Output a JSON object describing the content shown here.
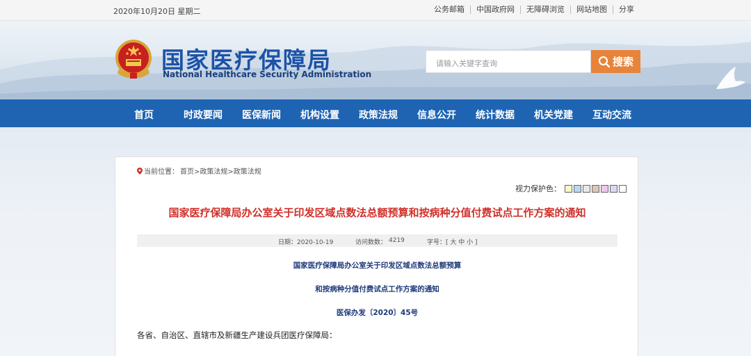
{
  "topbar": {
    "date": "2020年10月20日 星期二",
    "links": [
      "公务邮箱",
      "中国政府网",
      "无障碍浏览",
      "网站地图",
      "分享"
    ]
  },
  "header": {
    "title_cn": "国家医疗保障局",
    "title_en": "National Healthcare Security Administration",
    "search_placeholder": "请输入关键字查询",
    "search_button": "搜索"
  },
  "nav": {
    "items": [
      "首页",
      "时政要闻",
      "医保新闻",
      "机构设置",
      "政策法规",
      "信息公开",
      "统计数据",
      "机关党建",
      "互动交流"
    ]
  },
  "breadcrumb": {
    "prefix": "当前位置：",
    "path": "首页>政策法规>政策法规"
  },
  "eye_care": {
    "label": "视力保护色：",
    "swatches": [
      "#faf6c8",
      "#b8d8f0",
      "#e8e8e8",
      "#d8c8b8",
      "#f0c8e8",
      "#d8d8f8",
      "#ffffff"
    ]
  },
  "article": {
    "title": "国家医疗保障局办公室关于印发区域点数法总额预算和按病种分值付费试点工作方案的通知",
    "date_label": "日期：2020-10-19",
    "visits_label": "访问数数：",
    "visits_value": "4219",
    "font_label": "字号：[ 大 中 小 ]",
    "heading_line1": "国家医疗保障局办公室关于印发区域点数法总额预算",
    "heading_line2": "和按病种分值付费试点工作方案的通知",
    "doc_number": "医保办发〔2020〕45号",
    "salutation": "各省、自治区、直辖市及新疆生产建设兵团医疗保障局："
  },
  "colors": {
    "nav_blue": "#1e64b3",
    "title_blue": "#1c52a8",
    "search_orange": "#e8833a",
    "article_red": "#d0302a",
    "heading_navy": "#1f3a7a"
  }
}
